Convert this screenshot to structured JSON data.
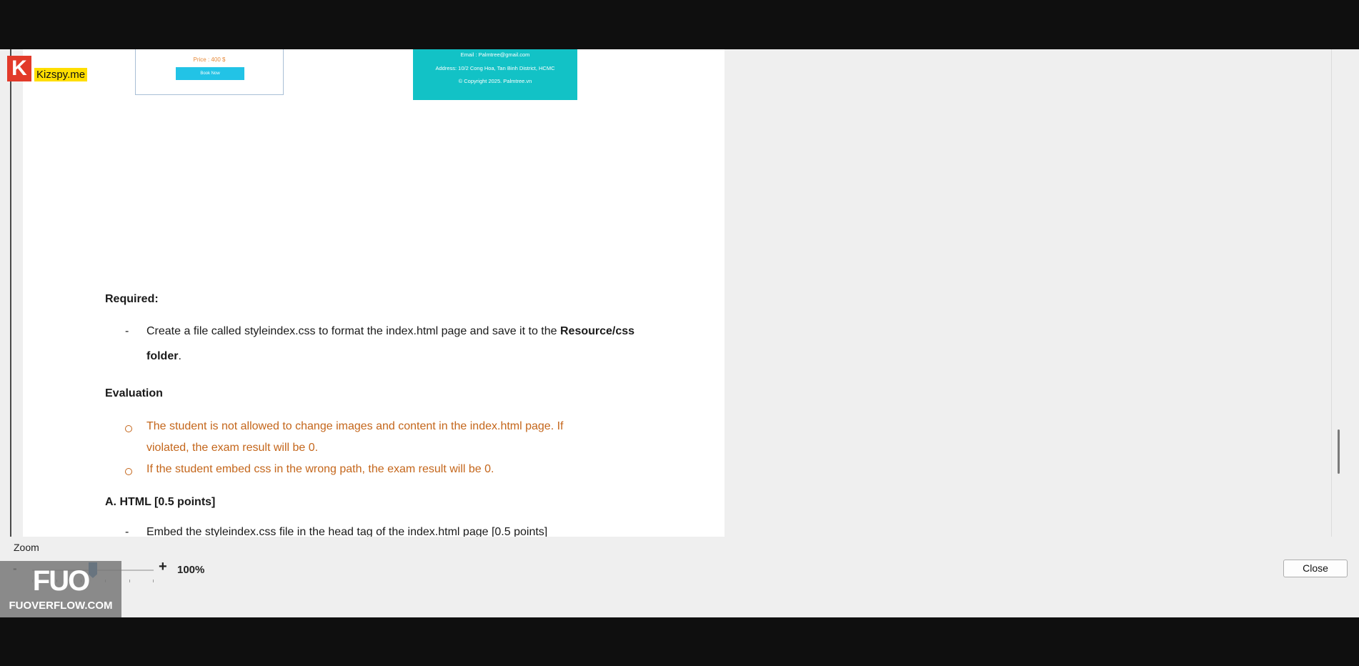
{
  "card": {
    "price": "Price : 400 $",
    "button": "Book Now"
  },
  "footer": {
    "email": "Email : Palmtree@gmail.com",
    "address": "Address: 10/2 Cong Hoa, Tan Binh District, HCMC",
    "copyright": "© Copyright 2025. Palmtree.vn"
  },
  "doc": {
    "required_heading": "Required:",
    "bullet_dash": "-",
    "required_line1_normal": "Create a file called styleindex.css to format the index.html page and save it to the ",
    "required_line1_bold": "Resource/css",
    "required_line2_bold": "folder",
    "required_line2_end": ".",
    "evaluation_heading": "Evaluation",
    "eval_1_line1": "The student is not allowed to change images and content in the index.html page. If",
    "eval_1_line2": "violated, the exam result will be 0.",
    "eval_2": "If the student embed css in the wrong path, the exam result will be 0.",
    "section_a_heading": "A. HTML  [0.5  points]",
    "section_a_item": "Embed the styleindex.css file in the head tag of the index.html page [0.5 points]"
  },
  "zoom": {
    "label": "Zoom",
    "minus": "-",
    "plus": "+",
    "value": "100%",
    "level_percent": 100
  },
  "close_label": "Close",
  "watermarks": {
    "kizspy_letter": "K",
    "kizspy": "Kizspy.me",
    "fuo_mark": "FUO",
    "fuo_site": "FUOVERFLOW.COM"
  }
}
